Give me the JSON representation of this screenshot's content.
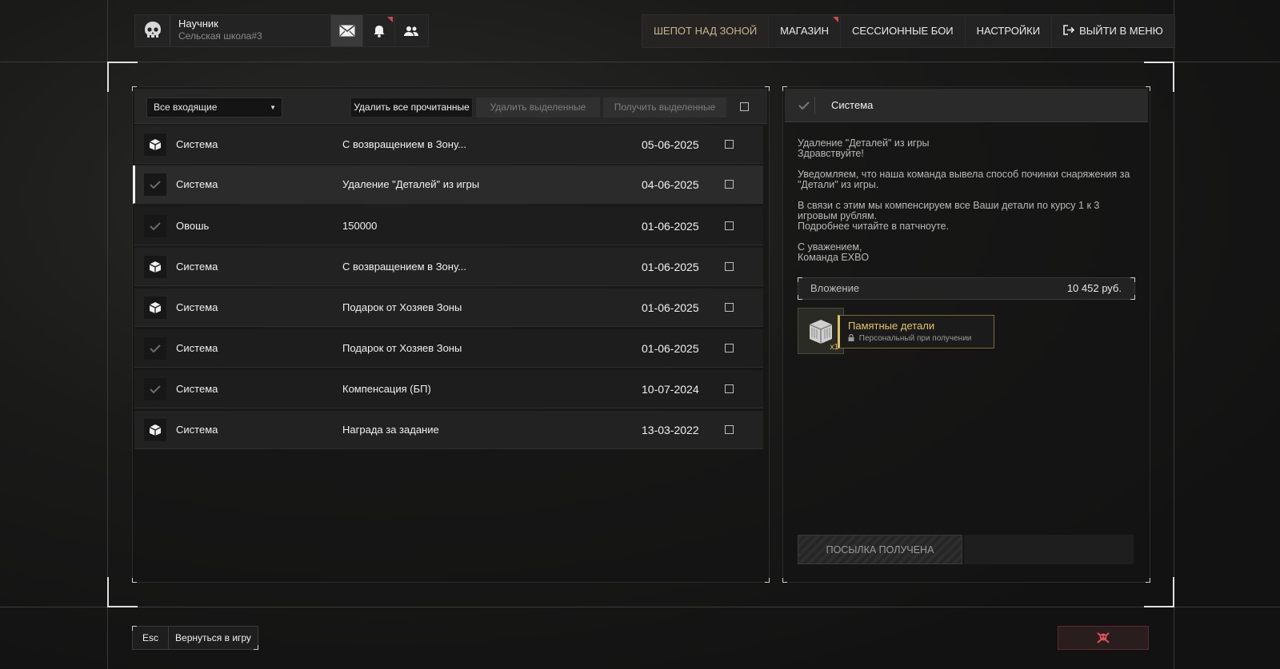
{
  "user": {
    "name": "Научник",
    "subtitle": "Сельская школа#3"
  },
  "top_buttons": {
    "mail_icon": "envelope-icon",
    "notifications_icon": "bell-icon",
    "friends_icon": "users-icon"
  },
  "nav": {
    "items": [
      "ШЕПОТ НАД ЗОНОЙ",
      "МАГАЗИН",
      "СЕССИОННЫЕ БОИ",
      "НАСТРОЙКИ",
      "ВЫЙТИ В МЕНЮ"
    ],
    "active_color": "#c9b58a"
  },
  "toolbar": {
    "filter_value": "Все входящие",
    "delete_read": "Удалить все прочитанные",
    "delete_selected": "Удалить выделенные",
    "get_selected": "Получить выделенные"
  },
  "mail_rows": [
    {
      "sender": "Система",
      "subject": "С возвращением в Зону...",
      "date": "05-06-2025",
      "icon": "package-icon"
    },
    {
      "sender": "Система",
      "subject": "Удаление \"Деталей\" из игры",
      "date": "04-06-2025",
      "icon": "check-icon"
    },
    {
      "sender": "Овошь",
      "subject": "150000",
      "date": "01-06-2025",
      "icon": "check-icon"
    },
    {
      "sender": "Система",
      "subject": "С возвращением в Зону...",
      "date": "01-06-2025",
      "icon": "package-icon"
    },
    {
      "sender": "Система",
      "subject": "Подарок от Хозяев Зоны",
      "date": "01-06-2025",
      "icon": "package-icon"
    },
    {
      "sender": "Система",
      "subject": "Подарок от Хозяев Зоны",
      "date": "01-06-2025",
      "icon": "check-icon"
    },
    {
      "sender": "Система",
      "subject": "Компенсация (БП)",
      "date": "10-07-2024",
      "icon": "check-icon"
    },
    {
      "sender": "Система",
      "subject": "Награда за задание",
      "date": "13-03-2022",
      "icon": "package-icon"
    }
  ],
  "message": {
    "sender": "Система",
    "line1": "Удаление \"Деталей\" из игры",
    "line2": "Здравствуйте!",
    "para2": "Уведомляем, что наша команда вывела способ починки снаряжения за \"Детали\" из игры.",
    "para3a": "В связи с этим мы компенсируем все Ваши детали по курсу 1 к 3 игровым рублям.",
    "para3b": "Подробнее читайте в патчноуте.",
    "sign1": "С уважением,",
    "sign2": "Команда EXBO",
    "attachment_label": "Вложение",
    "attachment_value": "10 452 руб.",
    "item_name": "Памятные детали",
    "item_note": "Персональный при получении",
    "item_qty": "x1",
    "received_label": "ПОСЫЛКА ПОЛУЧЕНА"
  },
  "bottom": {
    "esc_key": "Esc",
    "return_label": "Вернуться в игру"
  }
}
